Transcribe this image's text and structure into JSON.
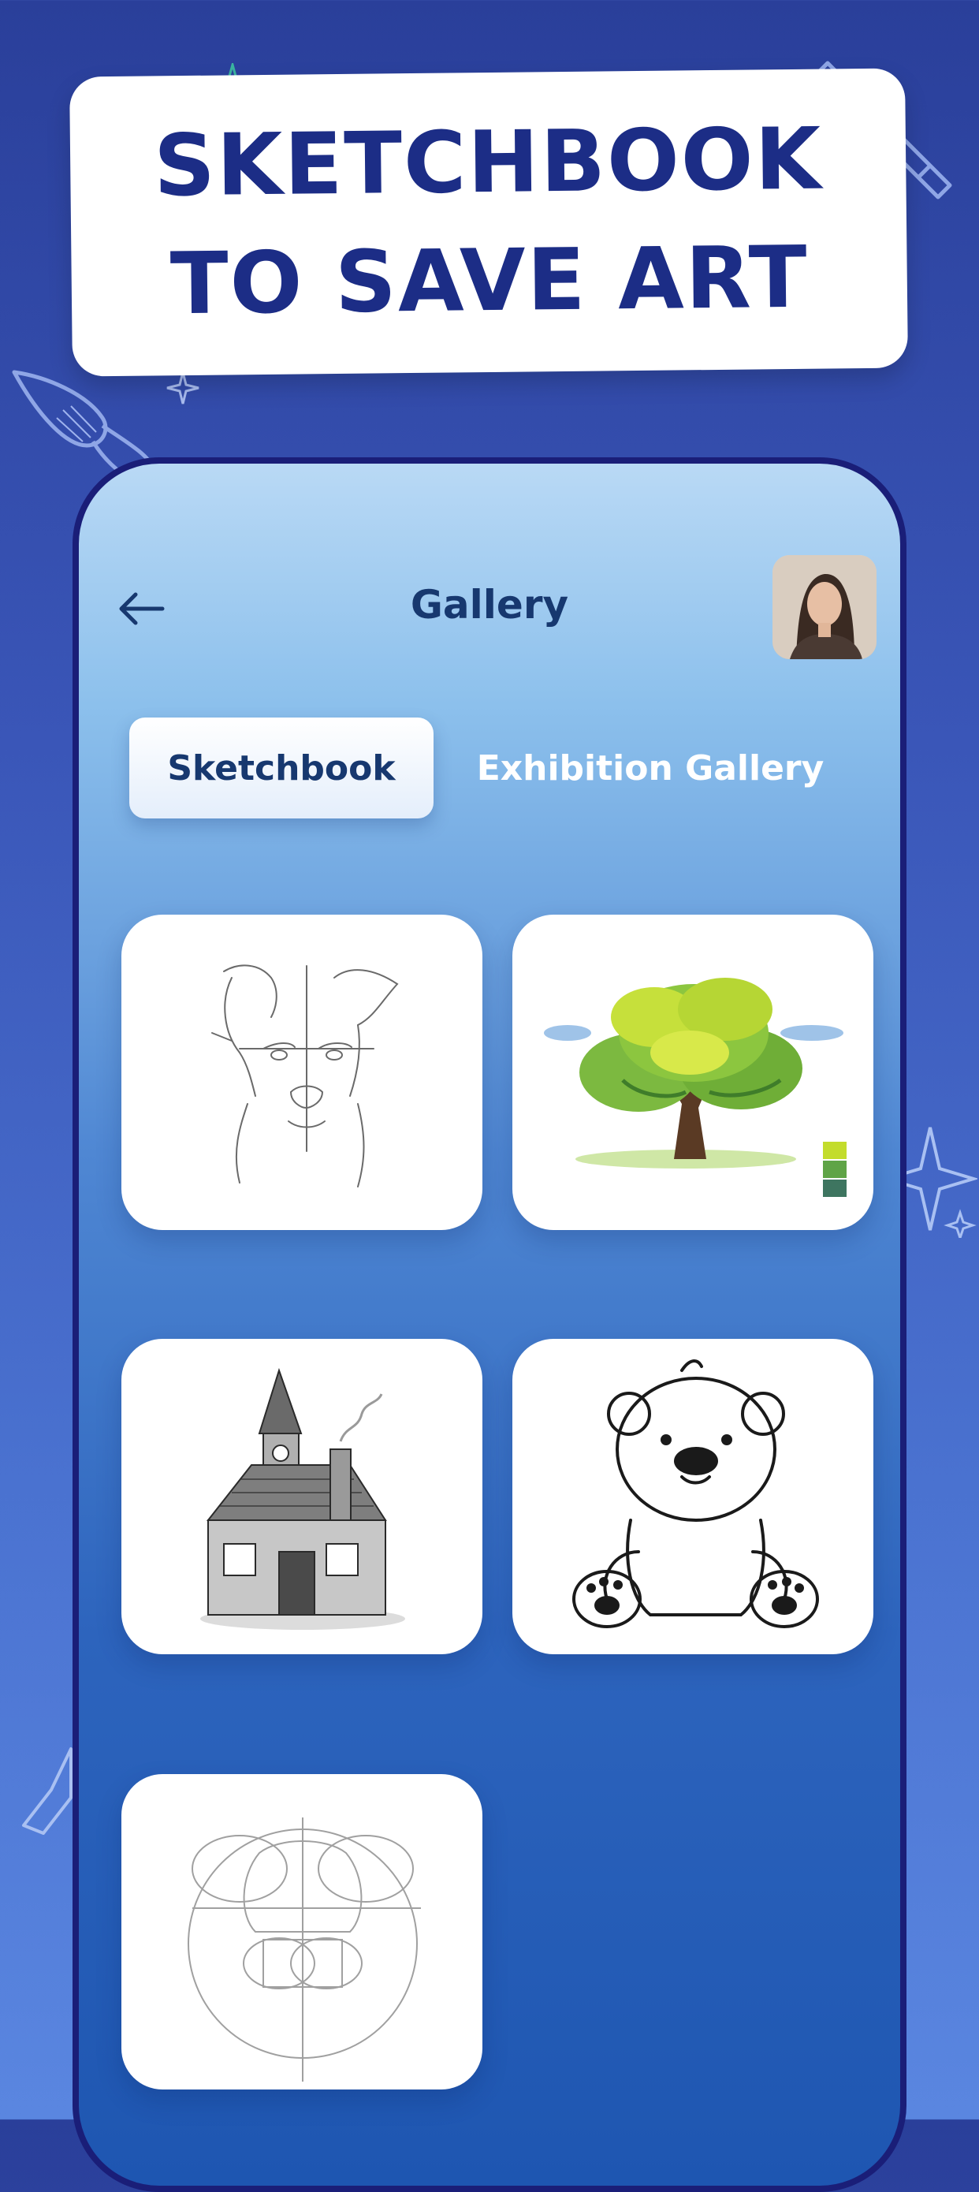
{
  "headline": {
    "line1": "SKETCHBOOK",
    "line2": "TO SAVE ART"
  },
  "header": {
    "title": "Gallery",
    "back_icon": "arrow-left-icon",
    "avatar": "user-avatar-photo"
  },
  "tabs": [
    {
      "label": "Sketchbook",
      "active": true
    },
    {
      "label": "Exhibition Gallery",
      "active": false
    }
  ],
  "gallery": {
    "items": [
      {
        "subject": "dog sketch"
      },
      {
        "subject": "tree painting"
      },
      {
        "subject": "house sketch"
      },
      {
        "subject": "teddy bear drawing"
      },
      {
        "subject": "bear construction sketch"
      }
    ]
  },
  "colors": {
    "background_top": "#2a3f9a",
    "background_bottom": "#5a86e0",
    "headline_text": "#1c2d86",
    "title_text": "#17386f",
    "phone_frame": "#1a1e78",
    "card_background": "#ffffff"
  }
}
